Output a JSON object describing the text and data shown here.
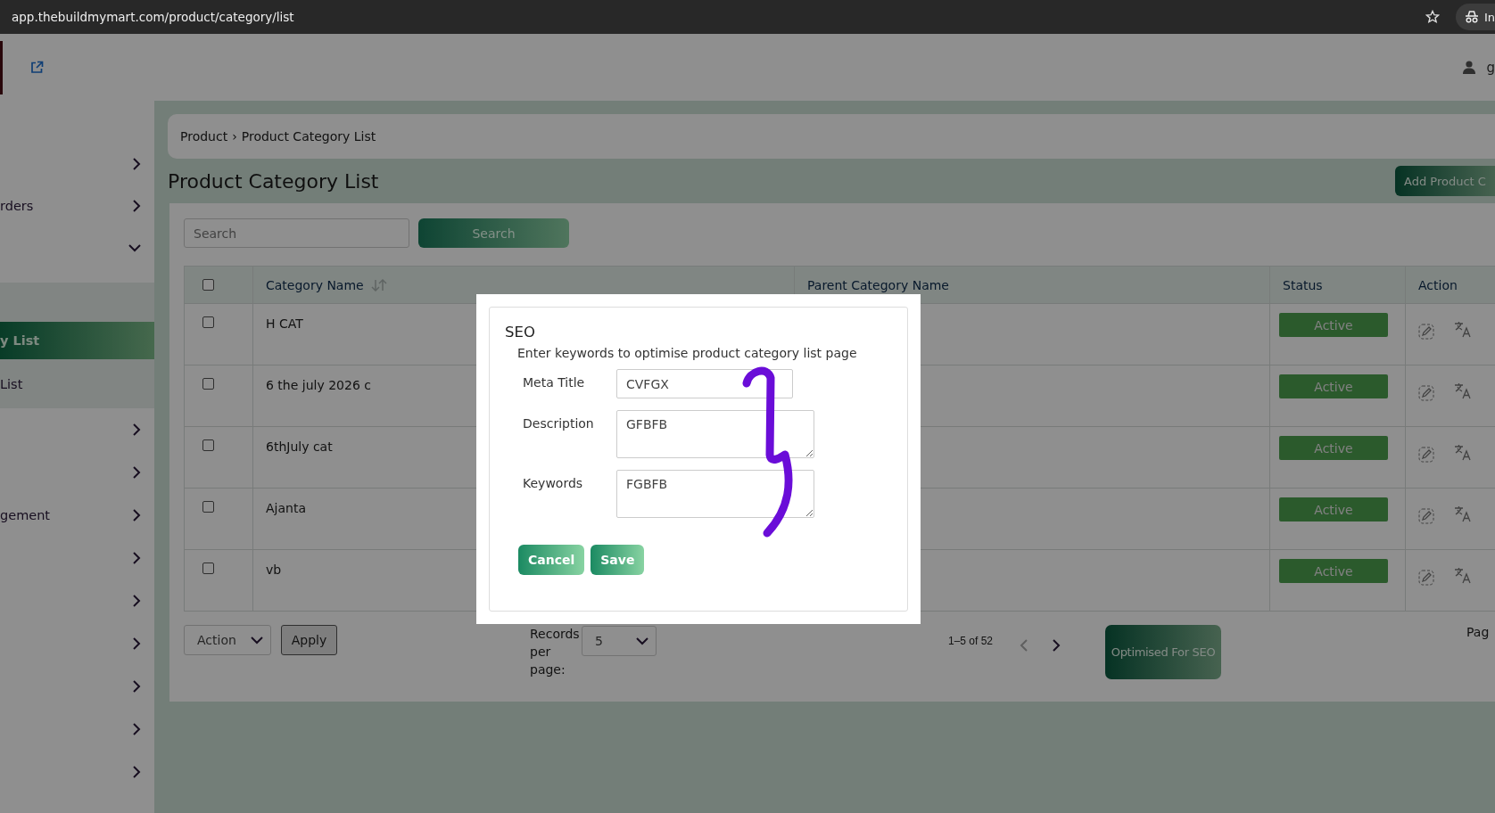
{
  "browser": {
    "url": "app.thebuildmymart.com/product/category/list",
    "profile_label": "In"
  },
  "header": {
    "user_name": "g"
  },
  "sidebar": {
    "items": [
      {
        "expanded": false
      },
      {
        "label": "rders",
        "expanded": false
      },
      {
        "expanded": true,
        "children": [
          {
            "label": "y List",
            "selected": true
          },
          {
            "label": "List",
            "selected": false
          }
        ]
      },
      {
        "expanded": false
      },
      {
        "expanded": false
      },
      {
        "label": "gement",
        "expanded": false
      },
      {
        "expanded": false
      },
      {
        "expanded": false
      },
      {
        "expanded": false
      },
      {
        "expanded": false
      },
      {
        "expanded": false
      },
      {
        "expanded": false
      }
    ]
  },
  "breadcrumb": {
    "parent": "Product",
    "separator": "›",
    "current": "Product Category List"
  },
  "page_title": "Product Category List",
  "add_button": "Add Product C",
  "search": {
    "placeholder": "Search",
    "button": "Search"
  },
  "table": {
    "select_all_checked": false,
    "columns": [
      "Category Name",
      "Parent Category Name",
      "Status",
      "Action"
    ],
    "rows": [
      {
        "checked": false,
        "name": "H CAT",
        "status": "Active"
      },
      {
        "checked": false,
        "name": "6 the july 2026 c",
        "status": "Active"
      },
      {
        "checked": false,
        "name": "6thJuly cat",
        "status": "Active"
      },
      {
        "checked": false,
        "name": "Ajanta",
        "status": "Active"
      },
      {
        "checked": false,
        "name": "vb",
        "status": "Active"
      }
    ]
  },
  "footer": {
    "bulk_action": "Action",
    "apply": "Apply",
    "records_label": "Records per page:",
    "records_value": "5",
    "range": "1–5 of 52",
    "prev_disabled": true,
    "next_disabled": false,
    "seo_button": "Optimised For SEO",
    "page_label": "Pag"
  },
  "modal": {
    "title": "SEO",
    "subtitle": "Enter keywords to optimise product category list page",
    "fields": [
      {
        "kind": "input",
        "label": "Meta Title",
        "value": "CVFGX"
      },
      {
        "kind": "textarea",
        "label": "Description",
        "value": "GFBFB"
      },
      {
        "kind": "textarea",
        "label": "Keywords",
        "value": "FGBFB"
      }
    ],
    "buttons": [
      "Cancel",
      "Save"
    ]
  }
}
